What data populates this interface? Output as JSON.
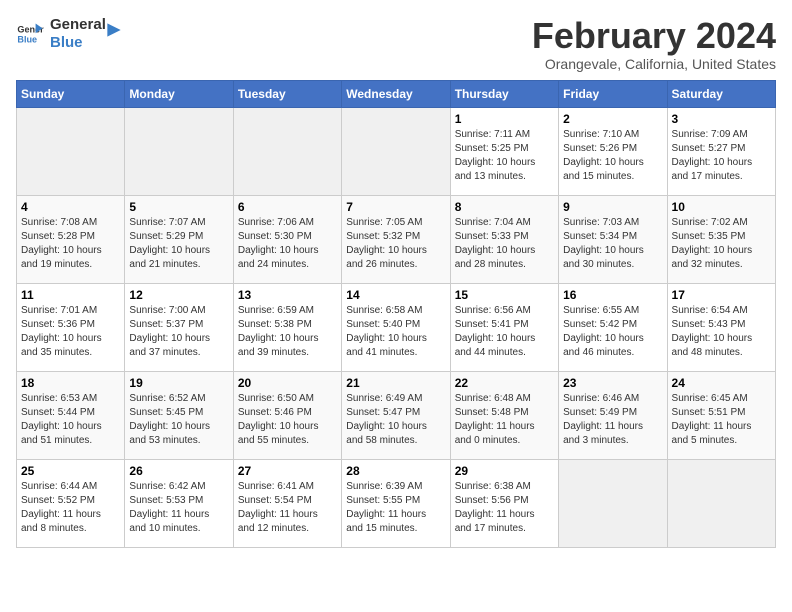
{
  "logo": {
    "text_general": "General",
    "text_blue": "Blue"
  },
  "header": {
    "title": "February 2024",
    "subtitle": "Orangevale, California, United States"
  },
  "days_of_week": [
    "Sunday",
    "Monday",
    "Tuesday",
    "Wednesday",
    "Thursday",
    "Friday",
    "Saturday"
  ],
  "weeks": [
    [
      {
        "day": "",
        "info": ""
      },
      {
        "day": "",
        "info": ""
      },
      {
        "day": "",
        "info": ""
      },
      {
        "day": "",
        "info": ""
      },
      {
        "day": "1",
        "info": "Sunrise: 7:11 AM\nSunset: 5:25 PM\nDaylight: 10 hours\nand 13 minutes."
      },
      {
        "day": "2",
        "info": "Sunrise: 7:10 AM\nSunset: 5:26 PM\nDaylight: 10 hours\nand 15 minutes."
      },
      {
        "day": "3",
        "info": "Sunrise: 7:09 AM\nSunset: 5:27 PM\nDaylight: 10 hours\nand 17 minutes."
      }
    ],
    [
      {
        "day": "4",
        "info": "Sunrise: 7:08 AM\nSunset: 5:28 PM\nDaylight: 10 hours\nand 19 minutes."
      },
      {
        "day": "5",
        "info": "Sunrise: 7:07 AM\nSunset: 5:29 PM\nDaylight: 10 hours\nand 21 minutes."
      },
      {
        "day": "6",
        "info": "Sunrise: 7:06 AM\nSunset: 5:30 PM\nDaylight: 10 hours\nand 24 minutes."
      },
      {
        "day": "7",
        "info": "Sunrise: 7:05 AM\nSunset: 5:32 PM\nDaylight: 10 hours\nand 26 minutes."
      },
      {
        "day": "8",
        "info": "Sunrise: 7:04 AM\nSunset: 5:33 PM\nDaylight: 10 hours\nand 28 minutes."
      },
      {
        "day": "9",
        "info": "Sunrise: 7:03 AM\nSunset: 5:34 PM\nDaylight: 10 hours\nand 30 minutes."
      },
      {
        "day": "10",
        "info": "Sunrise: 7:02 AM\nSunset: 5:35 PM\nDaylight: 10 hours\nand 32 minutes."
      }
    ],
    [
      {
        "day": "11",
        "info": "Sunrise: 7:01 AM\nSunset: 5:36 PM\nDaylight: 10 hours\nand 35 minutes."
      },
      {
        "day": "12",
        "info": "Sunrise: 7:00 AM\nSunset: 5:37 PM\nDaylight: 10 hours\nand 37 minutes."
      },
      {
        "day": "13",
        "info": "Sunrise: 6:59 AM\nSunset: 5:38 PM\nDaylight: 10 hours\nand 39 minutes."
      },
      {
        "day": "14",
        "info": "Sunrise: 6:58 AM\nSunset: 5:40 PM\nDaylight: 10 hours\nand 41 minutes."
      },
      {
        "day": "15",
        "info": "Sunrise: 6:56 AM\nSunset: 5:41 PM\nDaylight: 10 hours\nand 44 minutes."
      },
      {
        "day": "16",
        "info": "Sunrise: 6:55 AM\nSunset: 5:42 PM\nDaylight: 10 hours\nand 46 minutes."
      },
      {
        "day": "17",
        "info": "Sunrise: 6:54 AM\nSunset: 5:43 PM\nDaylight: 10 hours\nand 48 minutes."
      }
    ],
    [
      {
        "day": "18",
        "info": "Sunrise: 6:53 AM\nSunset: 5:44 PM\nDaylight: 10 hours\nand 51 minutes."
      },
      {
        "day": "19",
        "info": "Sunrise: 6:52 AM\nSunset: 5:45 PM\nDaylight: 10 hours\nand 53 minutes."
      },
      {
        "day": "20",
        "info": "Sunrise: 6:50 AM\nSunset: 5:46 PM\nDaylight: 10 hours\nand 55 minutes."
      },
      {
        "day": "21",
        "info": "Sunrise: 6:49 AM\nSunset: 5:47 PM\nDaylight: 10 hours\nand 58 minutes."
      },
      {
        "day": "22",
        "info": "Sunrise: 6:48 AM\nSunset: 5:48 PM\nDaylight: 11 hours\nand 0 minutes."
      },
      {
        "day": "23",
        "info": "Sunrise: 6:46 AM\nSunset: 5:49 PM\nDaylight: 11 hours\nand 3 minutes."
      },
      {
        "day": "24",
        "info": "Sunrise: 6:45 AM\nSunset: 5:51 PM\nDaylight: 11 hours\nand 5 minutes."
      }
    ],
    [
      {
        "day": "25",
        "info": "Sunrise: 6:44 AM\nSunset: 5:52 PM\nDaylight: 11 hours\nand 8 minutes."
      },
      {
        "day": "26",
        "info": "Sunrise: 6:42 AM\nSunset: 5:53 PM\nDaylight: 11 hours\nand 10 minutes."
      },
      {
        "day": "27",
        "info": "Sunrise: 6:41 AM\nSunset: 5:54 PM\nDaylight: 11 hours\nand 12 minutes."
      },
      {
        "day": "28",
        "info": "Sunrise: 6:39 AM\nSunset: 5:55 PM\nDaylight: 11 hours\nand 15 minutes."
      },
      {
        "day": "29",
        "info": "Sunrise: 6:38 AM\nSunset: 5:56 PM\nDaylight: 11 hours\nand 17 minutes."
      },
      {
        "day": "",
        "info": ""
      },
      {
        "day": "",
        "info": ""
      }
    ]
  ]
}
